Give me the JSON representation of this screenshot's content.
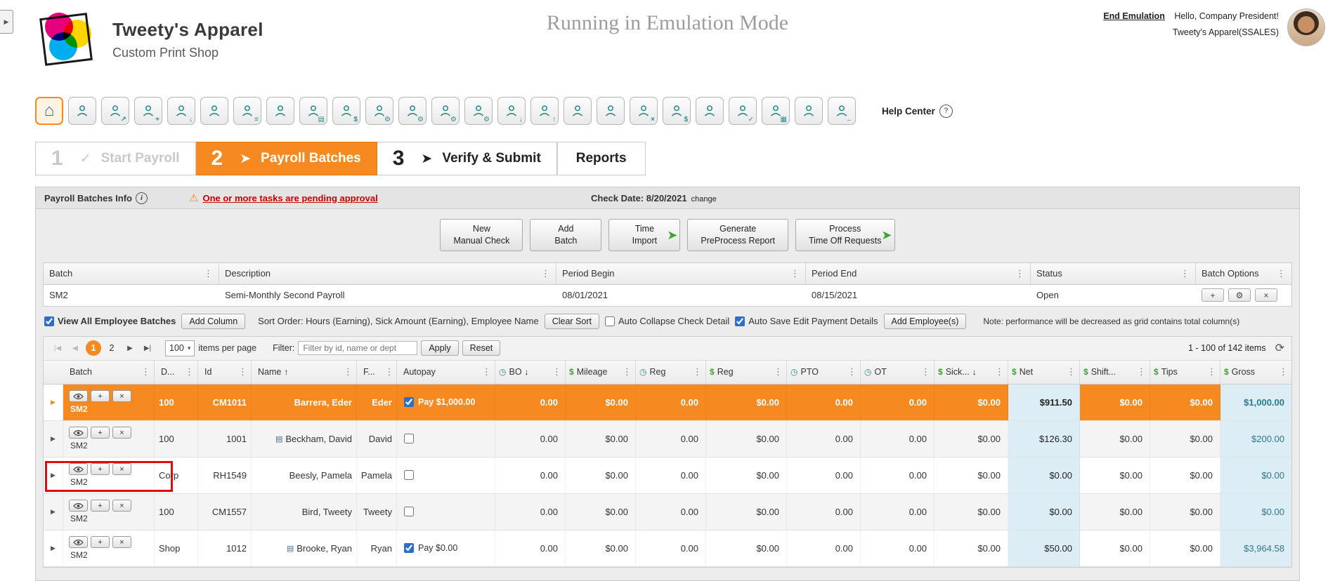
{
  "colors": {
    "accent_orange": "#F6891F",
    "icon_teal": "#2F8F8F",
    "arrow_green": "#3FA435",
    "warning_red": "#CC0000",
    "total_cell_blue": "#DCEDF5",
    "gross_text_teal": "#2B7A8C"
  },
  "glyphs": {
    "sidebar_toggle": "▶",
    "home": "⌂",
    "help": "?",
    "info": "i",
    "warning": "⚠",
    "kebab": "⋮",
    "expand_arrow": "▶",
    "row_add": "+",
    "row_delete": "×",
    "batch_add": "+",
    "batch_gear": "⚙",
    "batch_close": "×",
    "dropdown_caret": "▾",
    "refresh": "⟳"
  },
  "header": {
    "logo_title": "Tweety's Apparel",
    "logo_subtitle": "Custom Print Shop",
    "emulation_banner": "Running in Emulation Mode",
    "end_emulation": "End Emulation",
    "greeting": "Hello, Company President!",
    "account": "Tweety's Apparel(SSALES)"
  },
  "toolbar": {
    "help_label": "Help Center",
    "icons": [
      {
        "name": "employee-search-icon",
        "badge": ""
      },
      {
        "name": "employee-analytics-icon",
        "badge": "↗"
      },
      {
        "name": "new-hire-icon",
        "badge": "+"
      },
      {
        "name": "applicant-tracking-icon",
        "badge": "↓"
      },
      {
        "name": "team-icon",
        "badge": ""
      },
      {
        "name": "employee-list-icon",
        "badge": "≡"
      },
      {
        "name": "employee-profile-icon",
        "badge": ""
      },
      {
        "name": "forms-icon",
        "badge": "▤"
      },
      {
        "name": "payroll-icon",
        "badge": "$"
      },
      {
        "name": "payroll-process-icon",
        "badge": "⚙"
      },
      {
        "name": "payroll-settings-icon",
        "badge": "⚙"
      },
      {
        "name": "scheduling-icon",
        "badge": "⚙"
      },
      {
        "name": "integrations-icon",
        "badge": "⚙"
      },
      {
        "name": "import-icon",
        "badge": "↓"
      },
      {
        "name": "export-icon",
        "badge": "↑"
      },
      {
        "name": "security-icon",
        "badge": ""
      },
      {
        "name": "employee-audit-icon",
        "badge": ""
      },
      {
        "name": "terminated-employees-icon",
        "badge": "×"
      },
      {
        "name": "garnishments-icon",
        "badge": "$"
      },
      {
        "name": "org-structure-icon",
        "badge": ""
      },
      {
        "name": "approvals-icon",
        "badge": "✓"
      },
      {
        "name": "time-entry-grid-icon",
        "badge": "▦"
      },
      {
        "name": "timeclock-icon",
        "badge": ""
      },
      {
        "name": "sign-out-icon",
        "badge": "←"
      }
    ]
  },
  "steps": {
    "step1": {
      "num": "1",
      "mark": "✓",
      "label": "Start Payroll"
    },
    "step2": {
      "num": "2",
      "mark": "➤",
      "label": "Payroll Batches"
    },
    "step3": {
      "num": "3",
      "mark": "➤",
      "label": "Verify & Submit"
    },
    "reports": "Reports"
  },
  "panel": {
    "title": "Payroll Batches Info",
    "warning": "One or more tasks are pending approval",
    "check_date": "Check Date: 8/20/2021",
    "change_link": "change",
    "action_buttons": [
      {
        "name": "new-manual-check-button",
        "line1": "New",
        "line2": "Manual Check",
        "arrow": ""
      },
      {
        "name": "add-batch-button",
        "line1": "Add",
        "line2": "Batch",
        "arrow": ""
      },
      {
        "name": "time-import-button",
        "line1": "Time",
        "line2": "Import",
        "arrow": "➤"
      },
      {
        "name": "generate-preprocess-report-button",
        "line1": "Generate",
        "line2": "PreProcess Report",
        "arrow": ""
      },
      {
        "name": "process-time-off-requests-button",
        "line1": "Process",
        "line2": "Time Off Requests",
        "arrow": "➤"
      }
    ]
  },
  "batch_grid": {
    "columns": [
      "Batch",
      "Description",
      "Period Begin",
      "Period End",
      "Status",
      "Batch Options"
    ],
    "row": {
      "batch": "SM2",
      "description": "Semi-Monthly Second Payroll",
      "period_begin": "08/01/2021",
      "period_end": "08/15/2021",
      "status": "Open"
    }
  },
  "options_bar": {
    "view_all_label": "View All Employee Batches",
    "view_all_checked": true,
    "add_column": "Add Column",
    "sort_order": "Sort Order: Hours (Earning), Sick Amount (Earning), Employee Name",
    "clear_sort": "Clear Sort",
    "auto_collapse_label": "Auto Collapse Check Detail",
    "auto_collapse_checked": false,
    "auto_save_label": "Auto Save Edit Payment Details",
    "auto_save_checked": true,
    "add_employees": "Add Employee(s)",
    "note": "Note: performance will be decreased as grid contains total column(s)"
  },
  "pager": {
    "first": "|◀",
    "prev": "◀",
    "next": "▶",
    "last": "▶|",
    "pages": [
      {
        "label": "1",
        "active": true
      },
      {
        "label": "2",
        "active": false
      }
    ],
    "page_size": "100",
    "items_per_page": "items per page",
    "filter_label": "Filter:",
    "filter_placeholder": "Filter by id, name or dept",
    "apply": "Apply",
    "reset": "Reset",
    "range": "1 - 100 of 142 items"
  },
  "employee_grid": {
    "columns": [
      {
        "label": "Batch",
        "icon": "",
        "sort": ""
      },
      {
        "label": "D...",
        "icon": "",
        "sort": ""
      },
      {
        "label": "Id",
        "icon": "",
        "sort": ""
      },
      {
        "label": "Name",
        "icon": "",
        "sort": "↑"
      },
      {
        "label": "F...",
        "icon": "",
        "sort": ""
      },
      {
        "label": "Autopay",
        "icon": "",
        "sort": ""
      },
      {
        "label": "BO",
        "icon": "clock",
        "sort": "↓"
      },
      {
        "label": "Mileage",
        "icon": "dollar",
        "sort": ""
      },
      {
        "label": "Reg",
        "icon": "clock",
        "sort": ""
      },
      {
        "label": "Reg",
        "icon": "dollar",
        "sort": ""
      },
      {
        "label": "PTO",
        "icon": "clock",
        "sort": ""
      },
      {
        "label": "OT",
        "icon": "clock",
        "sort": ""
      },
      {
        "label": "Sick...",
        "icon": "dollar",
        "sort": "↓"
      },
      {
        "label": "Net",
        "icon": "dollar",
        "sort": ""
      },
      {
        "label": "Shift...",
        "icon": "dollar",
        "sort": ""
      },
      {
        "label": "Tips",
        "icon": "dollar",
        "sort": ""
      },
      {
        "label": "Gross",
        "icon": "dollar",
        "sort": ""
      }
    ],
    "rows": [
      {
        "state": "selected",
        "batch": "SM2",
        "dept": "100",
        "id": "CM1011",
        "doc": "",
        "name": "Barrera, Eder",
        "first": "Eder",
        "autopay_checked": true,
        "autopay_label": "Pay $1,000.00",
        "bo": "0.00",
        "mileage": "$0.00",
        "reg_hrs": "0.00",
        "reg_amt": "$0.00",
        "pto": "0.00",
        "ot": "0.00",
        "sick": "$0.00",
        "net": "$911.50",
        "shift": "$0.00",
        "tips": "$0.00",
        "gross": "$1,000.00"
      },
      {
        "state": "",
        "batch": "SM2",
        "dept": "100",
        "id": "1001",
        "doc": "▤",
        "name": "Beckham, David",
        "first": "David",
        "autopay_checked": false,
        "autopay_label": "",
        "bo": "0.00",
        "mileage": "$0.00",
        "reg_hrs": "0.00",
        "reg_amt": "$0.00",
        "pto": "0.00",
        "ot": "0.00",
        "sick": "$0.00",
        "net": "$126.30",
        "shift": "$0.00",
        "tips": "$0.00",
        "gross": "$200.00"
      },
      {
        "state": "annotated",
        "batch": "SM2",
        "dept": "Corp",
        "id": "RH1549",
        "doc": "",
        "name": "Beesly, Pamela",
        "first": "Pamela",
        "autopay_checked": false,
        "autopay_label": "",
        "bo": "0.00",
        "mileage": "$0.00",
        "reg_hrs": "0.00",
        "reg_amt": "$0.00",
        "pto": "0.00",
        "ot": "0.00",
        "sick": "$0.00",
        "net": "$0.00",
        "shift": "$0.00",
        "tips": "$0.00",
        "gross": "$0.00"
      },
      {
        "state": "",
        "batch": "SM2",
        "dept": "100",
        "id": "CM1557",
        "doc": "",
        "name": "Bird, Tweety",
        "first": "Tweety",
        "autopay_checked": false,
        "autopay_label": "",
        "bo": "0.00",
        "mileage": "$0.00",
        "reg_hrs": "0.00",
        "reg_amt": "$0.00",
        "pto": "0.00",
        "ot": "0.00",
        "sick": "$0.00",
        "net": "$0.00",
        "shift": "$0.00",
        "tips": "$0.00",
        "gross": "$0.00"
      },
      {
        "state": "",
        "batch": "SM2",
        "dept": "Shop",
        "id": "1012",
        "doc": "▤",
        "name": "Brooke, Ryan",
        "first": "Ryan",
        "autopay_checked": true,
        "autopay_label": "Pay $0.00",
        "bo": "0.00",
        "mileage": "$0.00",
        "reg_hrs": "0.00",
        "reg_amt": "$0.00",
        "pto": "0.00",
        "ot": "0.00",
        "sick": "$0.00",
        "net": "$50.00",
        "shift": "$0.00",
        "tips": "$0.00",
        "gross": "$3,964.58"
      }
    ]
  }
}
